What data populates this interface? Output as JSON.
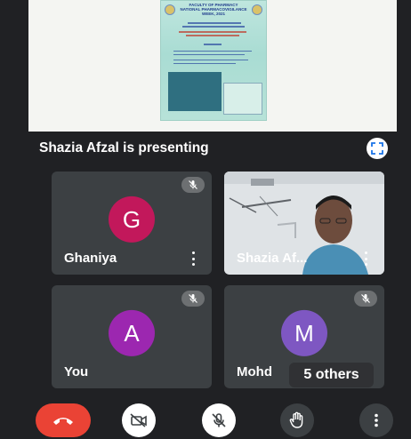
{
  "presentation": {
    "label": "Shazia Afzal is presenting",
    "slide": {
      "header_line1": "FACULTY OF PHARMACY",
      "header_line2": "NATIONAL PHARMACOVIGILANCE",
      "header_line3": "WEEK, 2021"
    }
  },
  "participants": [
    {
      "initial": "G",
      "name": "Ghaniya",
      "avatar_color": "#c2185b",
      "muted": true
    },
    {
      "name": "Shazia Af...",
      "video": true,
      "muted": false
    },
    {
      "initial": "A",
      "name": "You",
      "avatar_color": "#9c27b0",
      "muted": true
    },
    {
      "initial": "M",
      "name": "Mohd",
      "avatar_color": "#7e57c2",
      "muted": true
    }
  ],
  "others_label": "5 others",
  "controls": {
    "end_call_icon": "phone-hangup-icon",
    "camera_icon": "camera-off-icon",
    "mic_icon": "mic-off-icon",
    "hand_icon": "raise-hand-icon",
    "more_icon": "more-vert-icon"
  },
  "colors": {
    "background": "#202124",
    "tile": "#3c4043",
    "end_call": "#ea4335"
  }
}
